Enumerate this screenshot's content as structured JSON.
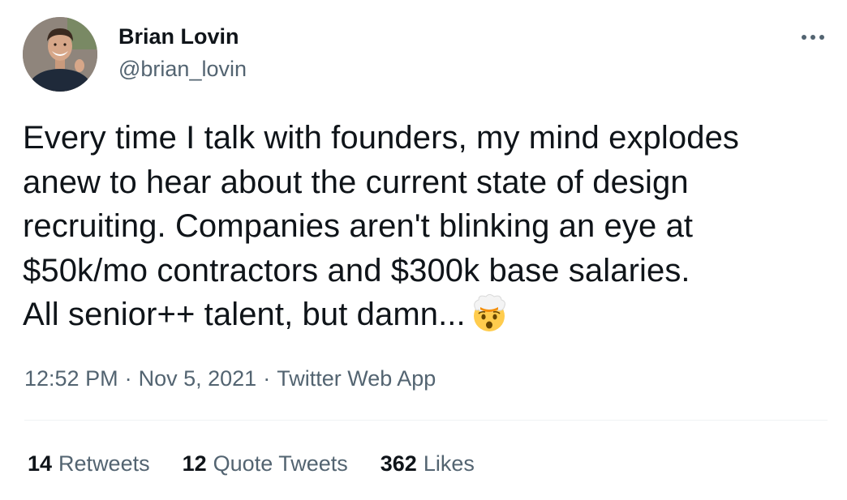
{
  "author": {
    "display_name": "Brian Lovin",
    "handle": "@brian_lovin",
    "avatar_icon": "user-avatar-photo"
  },
  "more_icon": "more-horizontal-icon",
  "tweet": {
    "lines": [
      "Every time I talk with founders, my mind explodes",
      "anew to hear about the current state of design",
      "recruiting. Companies aren't blinking an eye at",
      "$50k/mo contractors and $300k base salaries.",
      "All senior++ talent, but damn..."
    ],
    "emoji": "exploding-head-emoji"
  },
  "meta": {
    "time": "12:52 PM",
    "date": "Nov 5, 2021",
    "source": "Twitter Web App",
    "separator": "·"
  },
  "stats": {
    "retweets": {
      "count": "14",
      "label": "Retweets"
    },
    "quote_tweets": {
      "count": "12",
      "label": "Quote Tweets"
    },
    "likes": {
      "count": "362",
      "label": "Likes"
    }
  },
  "colors": {
    "text_primary": "#0f1419",
    "text_secondary": "#536471",
    "divider": "#eff3f4"
  }
}
